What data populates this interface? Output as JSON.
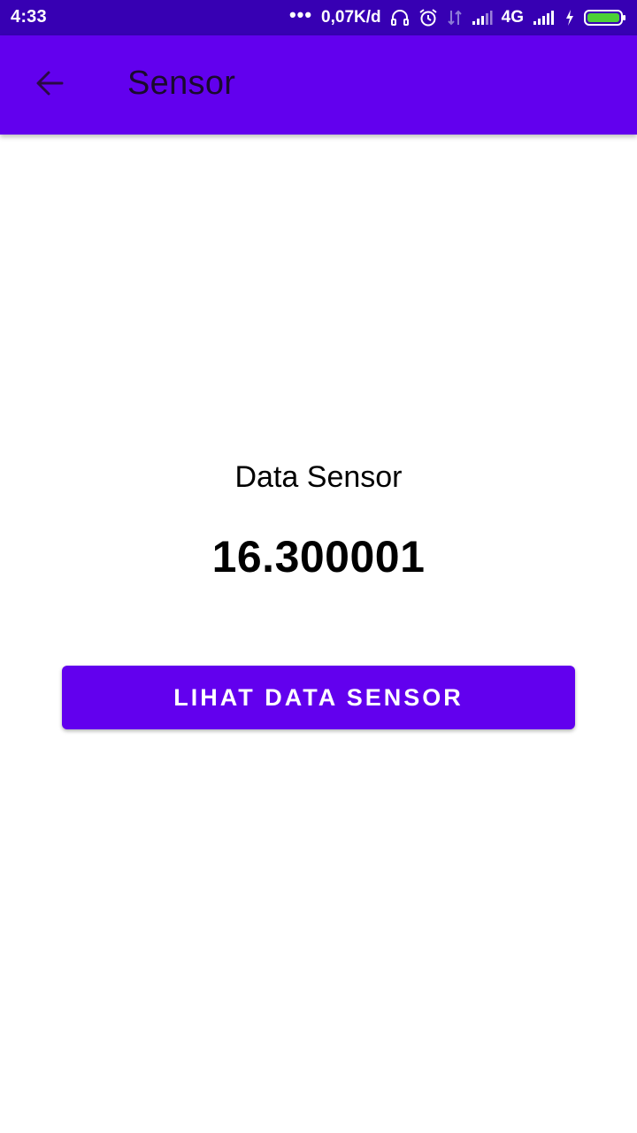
{
  "status_bar": {
    "time": "4:33",
    "more_dots": "•••",
    "speed": "0,07K/d",
    "network": "4G",
    "icons": [
      "headset-icon",
      "alarm-icon",
      "data-arrows-icon",
      "signal-icon",
      "signal-icon",
      "charging-icon",
      "battery-icon"
    ]
  },
  "app_bar": {
    "title": "Sensor",
    "back_icon": "arrow-left-icon"
  },
  "main": {
    "label": "Data Sensor",
    "value": "16.300001",
    "button_label": "LIHAT DATA SENSOR"
  },
  "colors": {
    "status_bar": "#3700B3",
    "primary": "#6200EE",
    "battery_fill": "#4CD137"
  }
}
